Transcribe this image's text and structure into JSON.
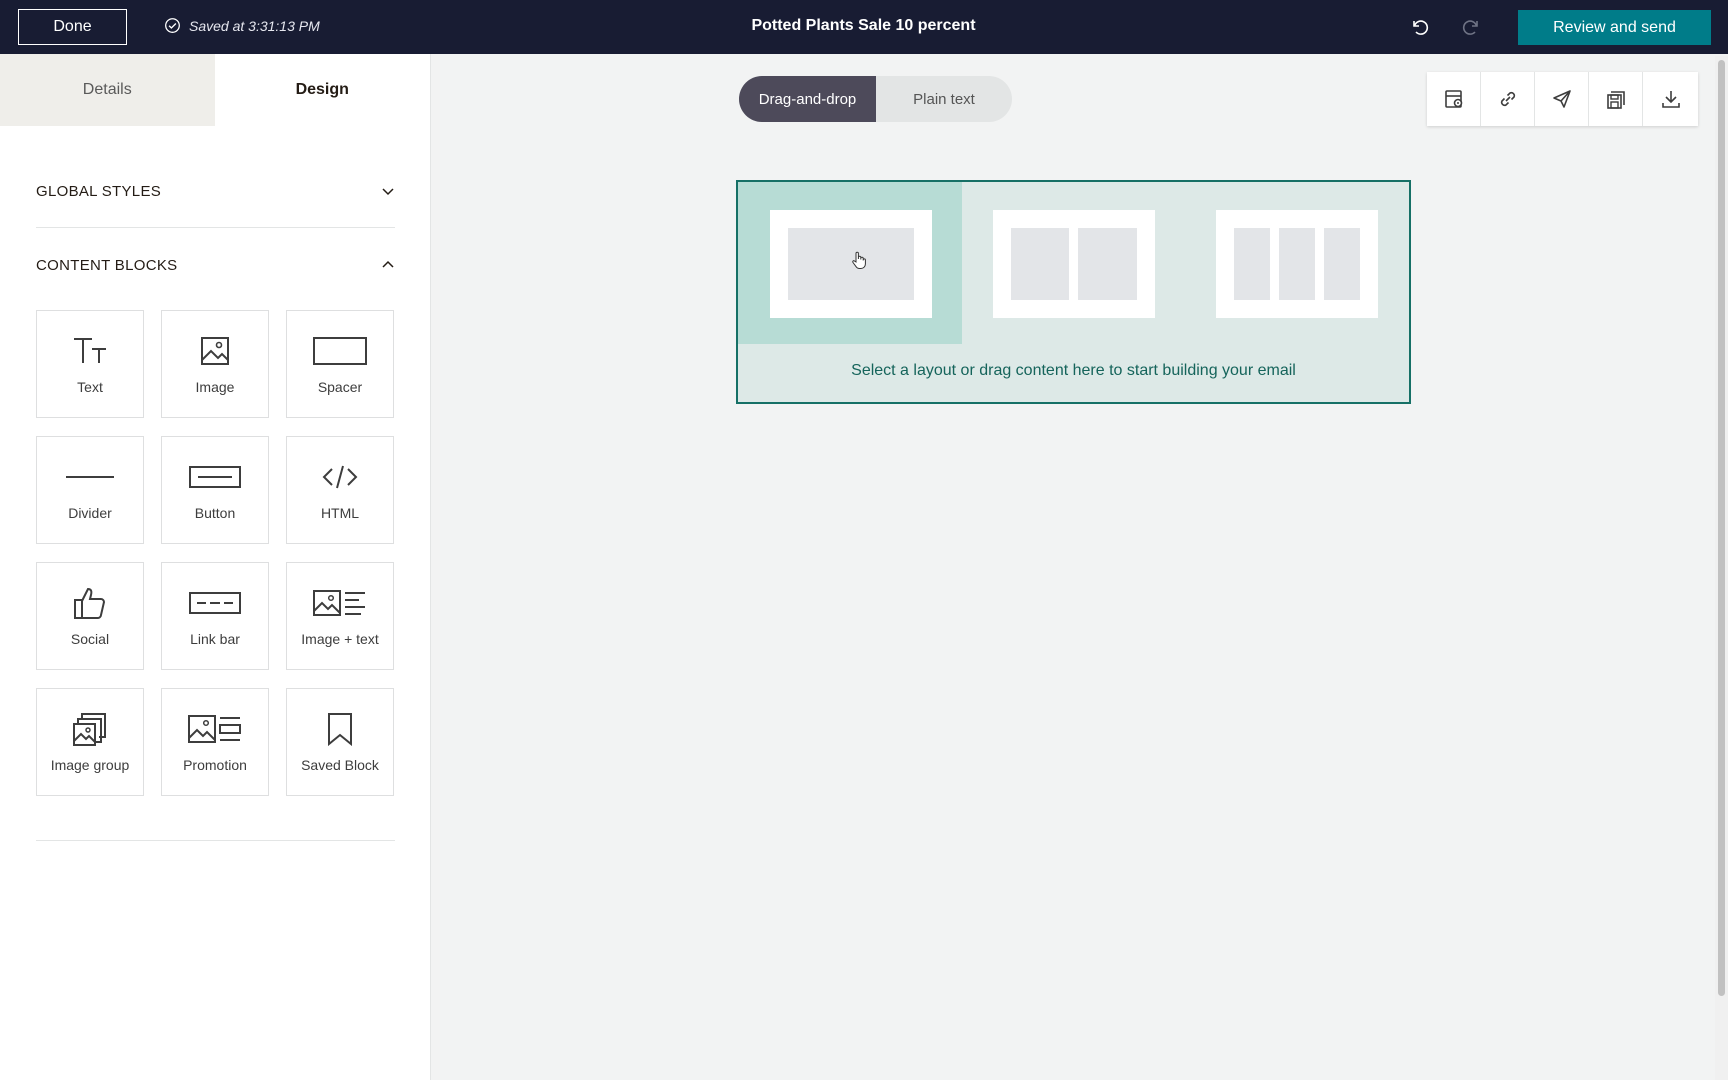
{
  "topbar": {
    "done_label": "Done",
    "saved_text": "Saved at 3:31:13 PM",
    "title": "Potted Plants Sale 10 percent",
    "review_label": "Review and send",
    "accent_color": "#007c89",
    "bar_color": "#181c33"
  },
  "sidebar": {
    "tabs": [
      {
        "label": "Details",
        "active": false
      },
      {
        "label": "Design",
        "active": true
      }
    ],
    "global_styles": {
      "label": "GLOBAL STYLES",
      "expanded": false
    },
    "content_blocks": {
      "label": "CONTENT BLOCKS",
      "expanded": true,
      "items": [
        {
          "label": "Text",
          "icon": "text-icon"
        },
        {
          "label": "Image",
          "icon": "image-icon"
        },
        {
          "label": "Spacer",
          "icon": "spacer-icon"
        },
        {
          "label": "Divider",
          "icon": "divider-icon"
        },
        {
          "label": "Button",
          "icon": "button-icon"
        },
        {
          "label": "HTML",
          "icon": "code-icon"
        },
        {
          "label": "Social",
          "icon": "thumbs-up-icon"
        },
        {
          "label": "Link bar",
          "icon": "link-bar-icon"
        },
        {
          "label": "Image + text",
          "icon": "image-text-icon"
        },
        {
          "label": "Image group",
          "icon": "image-group-icon"
        },
        {
          "label": "Promotion",
          "icon": "promotion-icon"
        },
        {
          "label": "Saved Block",
          "icon": "bookmark-icon"
        }
      ]
    }
  },
  "canvas": {
    "mode_toggle": [
      {
        "label": "Drag-and-drop",
        "selected": true
      },
      {
        "label": "Plain text",
        "selected": false
      }
    ],
    "toolbar_icons": [
      "preview-icon",
      "link-icon",
      "send-test-icon",
      "save-template-icon",
      "download-icon"
    ],
    "dropzone_text": "Select a layout or drag content here to start building your email",
    "layouts": [
      {
        "columns": 1,
        "hovered": true
      },
      {
        "columns": 2,
        "hovered": false
      },
      {
        "columns": 3,
        "hovered": false
      }
    ]
  }
}
